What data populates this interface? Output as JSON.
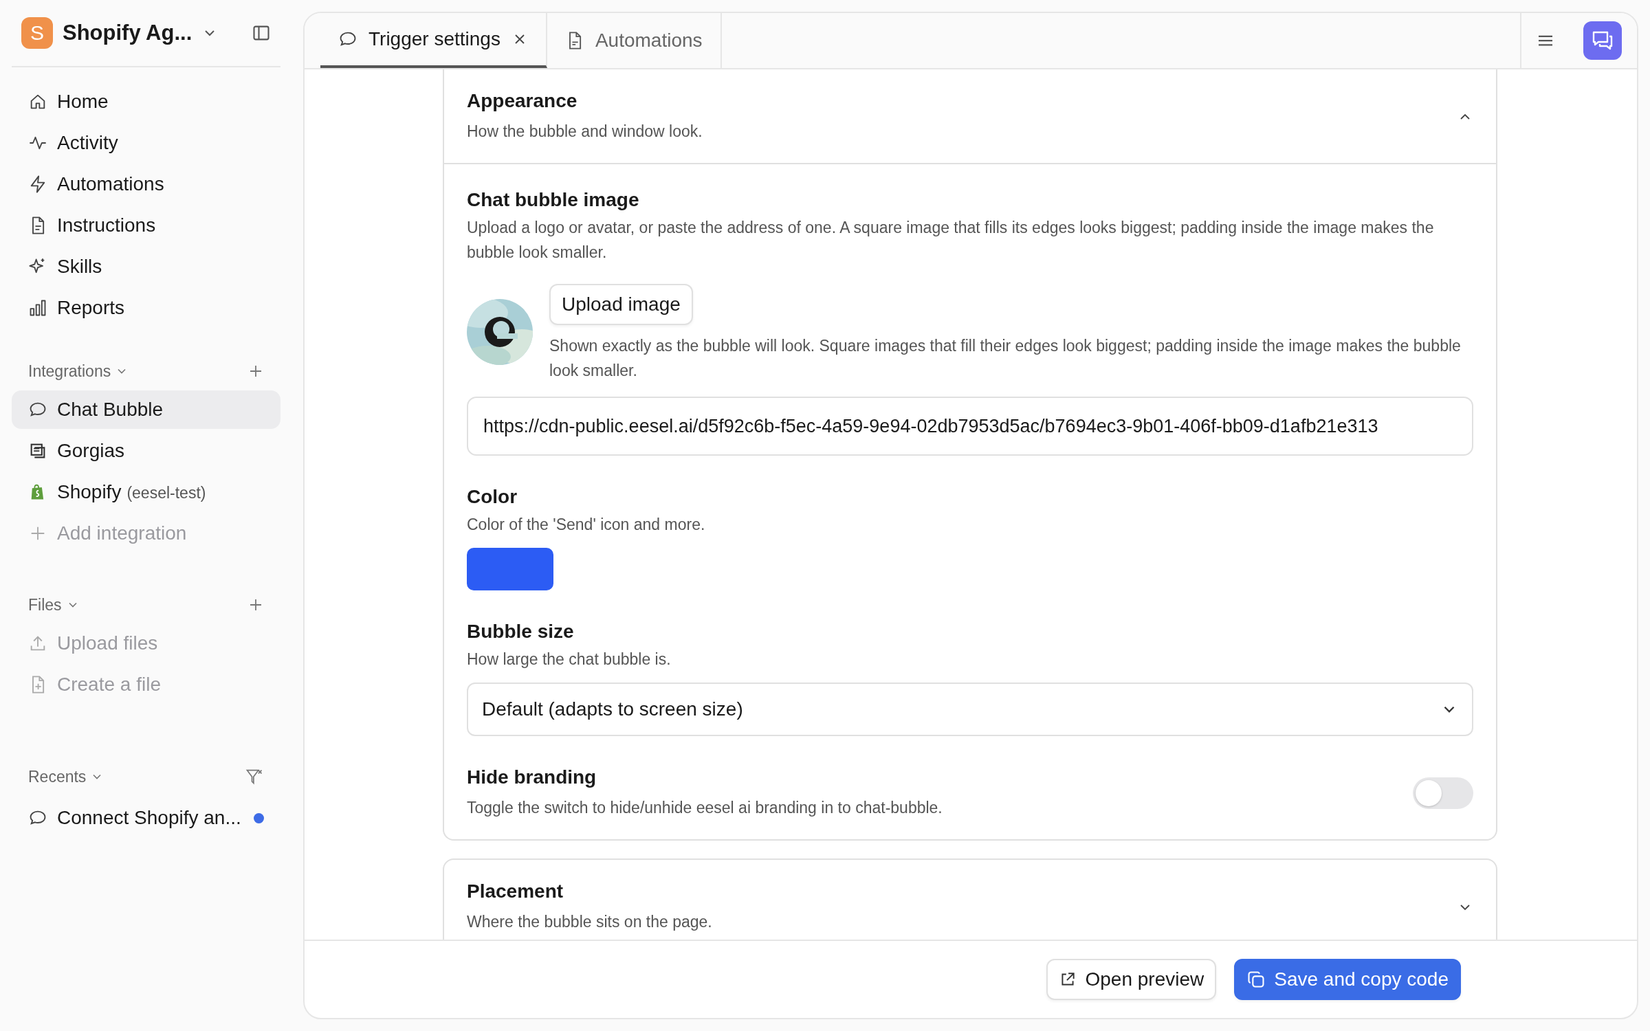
{
  "workspace": {
    "initial": "S",
    "name": "Shopify Ag..."
  },
  "nav": [
    {
      "label": "Home"
    },
    {
      "label": "Activity"
    },
    {
      "label": "Automations"
    },
    {
      "label": "Instructions"
    },
    {
      "label": "Skills"
    },
    {
      "label": "Reports"
    }
  ],
  "integrations": {
    "title": "Integrations",
    "items": [
      {
        "label": "Chat Bubble",
        "selected": true,
        "disabled": false
      },
      {
        "label": "Gorgias",
        "selected": false,
        "disabled": false
      },
      {
        "label": "Shopify",
        "note": "(eesel-test)",
        "selected": false,
        "disabled": false
      },
      {
        "label": "Add integration",
        "selected": false,
        "disabled": true
      }
    ]
  },
  "files": {
    "title": "Files",
    "items": [
      {
        "label": "Upload files",
        "disabled": true
      },
      {
        "label": "Create a file",
        "disabled": true
      }
    ]
  },
  "recents": {
    "title": "Recents",
    "items": [
      {
        "label": "Connect Shopify an...",
        "unread": true
      }
    ]
  },
  "tabs": [
    {
      "label": "Trigger settings",
      "selected": true
    },
    {
      "label": "Automations",
      "selected": false
    }
  ],
  "sections": [
    {
      "title": "Appearance",
      "description": "How the bubble and window look.",
      "expanded": true
    },
    {
      "title": "Placement",
      "description": "Where the bubble sits on the page.",
      "expanded": false
    }
  ],
  "bubble_image": {
    "title": "Chat bubble image",
    "description": "Upload a logo or avatar, or paste the address of one. A square image that fills its edges looks biggest; padding inside the image makes the bubble look smaller.",
    "upload_label": "Upload image",
    "hint": "Shown exactly as the bubble will look. Square images that fill their edges look biggest; padding inside the image makes the bubble look smaller.",
    "url": "https://cdn-public.eesel.ai/d5f92c6b-f5ec-4a59-9e94-02db7953d5ac/b7694ec3-9b01-406f-bb09-d1afb21e313"
  },
  "color": {
    "title": "Color",
    "description": "Color of the 'Send' icon and more.",
    "color": "#2c5cf4"
  },
  "bubble_size": {
    "title": "Bubble size",
    "description": "How large the chat bubble is.",
    "value": "Default (adapts to screen size)"
  },
  "hide_branding": {
    "title": "Hide branding",
    "description": "Toggle the switch to hide/unhide eesel ai branding in to chat-bubble.",
    "on": false
  },
  "footer": {
    "preview": "Open preview",
    "save": "Save and copy code"
  }
}
